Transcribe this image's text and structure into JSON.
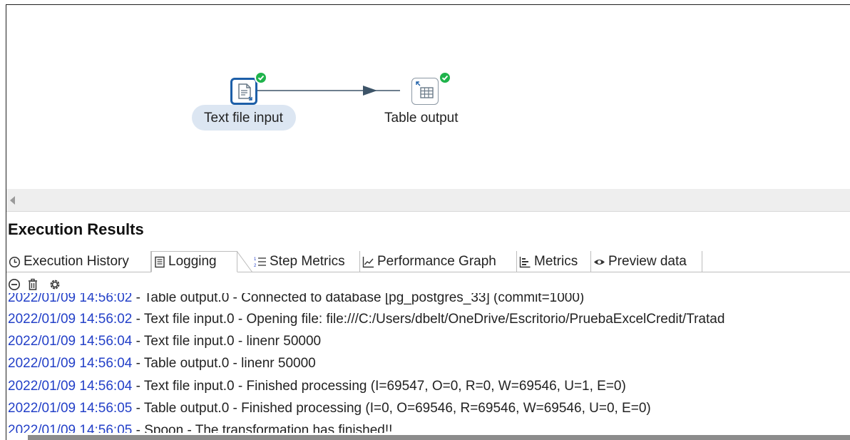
{
  "canvas": {
    "steps": [
      {
        "label": "Text file input",
        "icon": "text-file-input-icon",
        "status": "success"
      },
      {
        "label": "Table output",
        "icon": "table-output-icon",
        "status": "success"
      }
    ]
  },
  "results": {
    "title": "Execution Results",
    "tabs": [
      {
        "label": "Execution History",
        "icon": "history-icon"
      },
      {
        "label": "Logging",
        "icon": "logging-icon",
        "active": true
      },
      {
        "label": "Step Metrics",
        "icon": "step-metrics-icon"
      },
      {
        "label": "Performance Graph",
        "icon": "performance-graph-icon"
      },
      {
        "label": "Metrics",
        "icon": "metrics-icon"
      },
      {
        "label": "Preview data",
        "icon": "preview-eye-icon"
      }
    ],
    "toolbar": [
      "stop-icon",
      "trash-icon",
      "settings-gear-icon"
    ]
  },
  "log": [
    {
      "ts": "2022/01/09 14:56:02",
      "msg": " - Table output.0 - Connected to database [pg_postgres_33] (commit=1000)"
    },
    {
      "ts": "2022/01/09 14:56:02",
      "msg": " - Text file input.0 - Opening file: file:///C:/Users/dbelt/OneDrive/Escritorio/PruebaExcelCredit/Tratad"
    },
    {
      "ts": "2022/01/09 14:56:04",
      "msg": " - Text file input.0 - linenr 50000"
    },
    {
      "ts": "2022/01/09 14:56:04",
      "msg": " - Table output.0 - linenr 50000"
    },
    {
      "ts": "2022/01/09 14:56:04",
      "msg": " - Text file input.0 - Finished processing (I=69547, O=0, R=0, W=69546, U=1, E=0)"
    },
    {
      "ts": "2022/01/09 14:56:05",
      "msg": " - Table output.0 - Finished processing (I=0, O=69546, R=69546, W=69546, U=0, E=0)"
    },
    {
      "ts": "2022/01/09 14:56:05",
      "msg": " - Spoon - The transformation has finished!!"
    }
  ],
  "colors": {
    "timestamp": "#2340c8",
    "success": "#1fb34b",
    "step_border": "#1d5fa8",
    "selection_bg": "#dce6f2"
  }
}
